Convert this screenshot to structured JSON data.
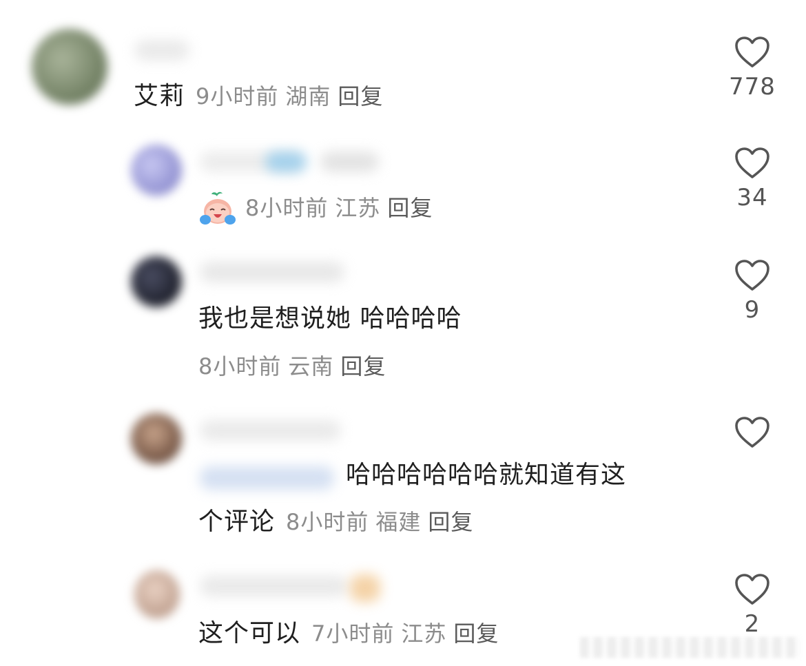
{
  "comments": [
    {
      "text": "艾莉",
      "time": "9小时前",
      "location": "湖南",
      "reply_label": "回复",
      "likes": "778",
      "avatar_color": "#7d8a70"
    },
    {
      "emoji": "crying-laughing-peach-emoji",
      "time": "8小时前",
      "location": "江苏",
      "reply_label": "回复",
      "likes": "34",
      "avatar_color": "#b4b4e6"
    },
    {
      "text": "我也是想说她 哈哈哈哈",
      "time": "8小时前",
      "location": "云南",
      "reply_label": "回复",
      "likes": "9",
      "avatar_color": "#2e3140"
    },
    {
      "text_line1": "哈哈哈哈哈哈就知道有这",
      "text_line2": "个评论",
      "time": "8小时前",
      "location": "福建",
      "reply_label": "回复",
      "avatar_color": "#8a6a55"
    },
    {
      "text": "这个可以",
      "time": "7小时前",
      "location": "江苏",
      "reply_label": "回复",
      "likes": "2",
      "avatar_color": "#d9b9a8"
    }
  ],
  "icons": {
    "like": "heart-outline-icon"
  }
}
